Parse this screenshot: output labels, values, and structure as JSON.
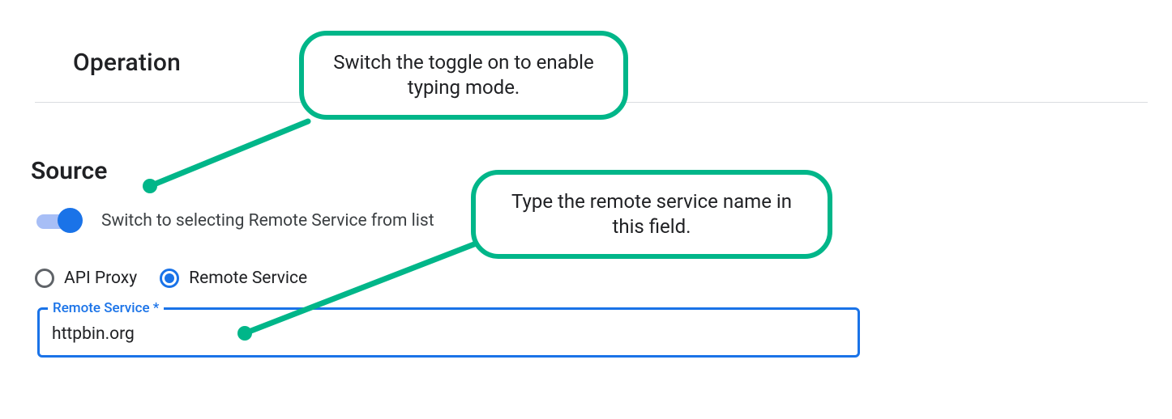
{
  "headings": {
    "operation": "Operation",
    "source": "Source"
  },
  "toggle": {
    "label": "Switch to selecting Remote Service from list",
    "on": true
  },
  "radios": {
    "api_proxy": {
      "label": "API Proxy",
      "selected": false
    },
    "remote_service": {
      "label": "Remote Service",
      "selected": true
    }
  },
  "field": {
    "label": "Remote Service *",
    "value": "httpbin.org"
  },
  "callouts": {
    "toggle": "Switch the toggle on to enable typing mode.",
    "field": "Type the remote service name in this field."
  },
  "colors": {
    "accent": "#00b689",
    "primary": "#1a73e8"
  }
}
